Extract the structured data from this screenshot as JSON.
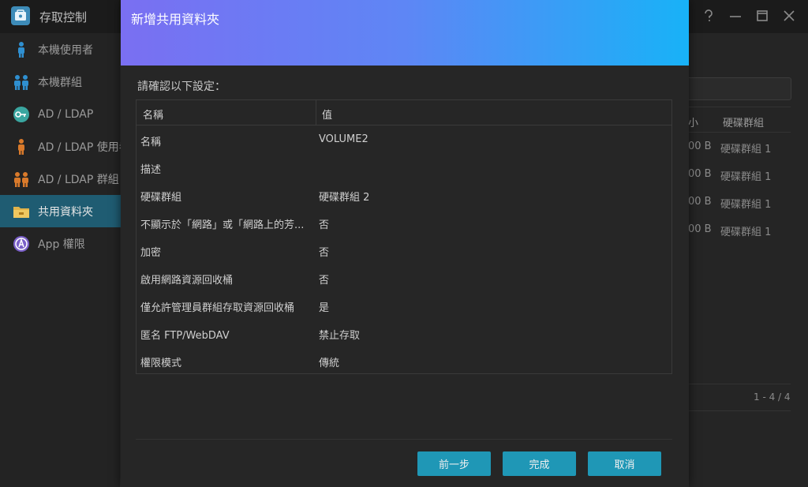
{
  "app": {
    "title": "存取控制",
    "icon": "access-control-icon"
  },
  "window_controls": [
    "help-icon",
    "minimize-icon",
    "maximize-icon",
    "close-icon"
  ],
  "sidebar": {
    "items": [
      {
        "label": "本機使用者",
        "icon": "local-user-icon",
        "active": false
      },
      {
        "label": "本機群組",
        "icon": "local-group-icon",
        "active": false
      },
      {
        "label": "AD / LDAP",
        "icon": "key-icon",
        "active": false
      },
      {
        "label": "AD / LDAP 使用者",
        "icon": "ad-user-icon",
        "active": false
      },
      {
        "label": "AD / LDAP 群組",
        "icon": "ad-group-icon",
        "active": false
      },
      {
        "label": "共用資料夾",
        "icon": "folder-icon",
        "active": true
      },
      {
        "label": "App 權限",
        "icon": "app-icon",
        "active": false
      }
    ]
  },
  "background_table": {
    "headers": [
      "小",
      "硬碟群組"
    ],
    "rows": [
      {
        "size": "00 B",
        "volume": "硬碟群組 1"
      },
      {
        "size": "00 B",
        "volume": "硬碟群組 1"
      },
      {
        "size": "00 B",
        "volume": "硬碟群組 1"
      },
      {
        "size": "00 B",
        "volume": "硬碟群組 1"
      }
    ],
    "pager": "1 - 4 / 4"
  },
  "dialog": {
    "title": "新增共用資料夾",
    "confirm_label": "請確認以下設定：",
    "table": {
      "headers": {
        "name": "名稱",
        "value": "值"
      },
      "rows": [
        {
          "name": "名稱",
          "value": "VOLUME2"
        },
        {
          "name": "描述",
          "value": ""
        },
        {
          "name": "硬碟群組",
          "value": "硬碟群組 2"
        },
        {
          "name": "不顯示於「網路」或「網路上的芳...",
          "value": "否"
        },
        {
          "name": "加密",
          "value": "否"
        },
        {
          "name": "啟用網路資源回收桶",
          "value": "否"
        },
        {
          "name": "僅允許管理員群組存取資源回收桶",
          "value": "是"
        },
        {
          "name": "匿名 FTP/WebDAV",
          "value": "禁止存取"
        },
        {
          "name": "權限模式",
          "value": "傳統"
        }
      ]
    },
    "buttons": {
      "back": "前一步",
      "finish": "完成",
      "cancel": "取消"
    }
  },
  "colors": {
    "header_gradient_start": "#7a6ff2",
    "header_gradient_end": "#18b2f7",
    "button": "#1f97b6",
    "sidebar_active": "#1f5c72"
  }
}
